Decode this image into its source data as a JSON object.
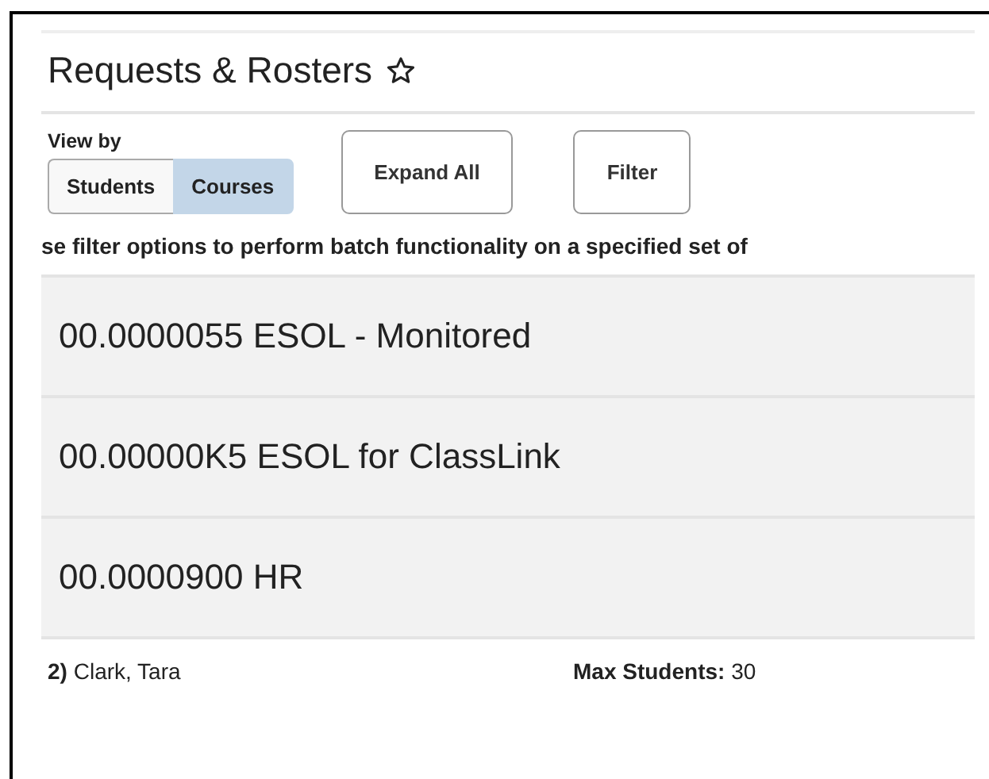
{
  "title": "Requests & Rosters",
  "favorite": false,
  "view_by": {
    "label": "View by",
    "options": [
      {
        "label": "Students",
        "selected": false
      },
      {
        "label": "Courses",
        "selected": true
      }
    ]
  },
  "buttons": [
    "Expand All",
    "Filter"
  ],
  "instruction": "se filter options to perform batch functionality on a specified set of",
  "courses": [
    {
      "label": "00.0000055 ESOL - Monitored"
    },
    {
      "label": "00.00000K5 ESOL for ClassLink"
    },
    {
      "label": "00.0000900 HR"
    }
  ],
  "detail": {
    "teacher": "**2)** Clark, Tara",
    "max_students": "**Max Students:** 30"
  }
}
